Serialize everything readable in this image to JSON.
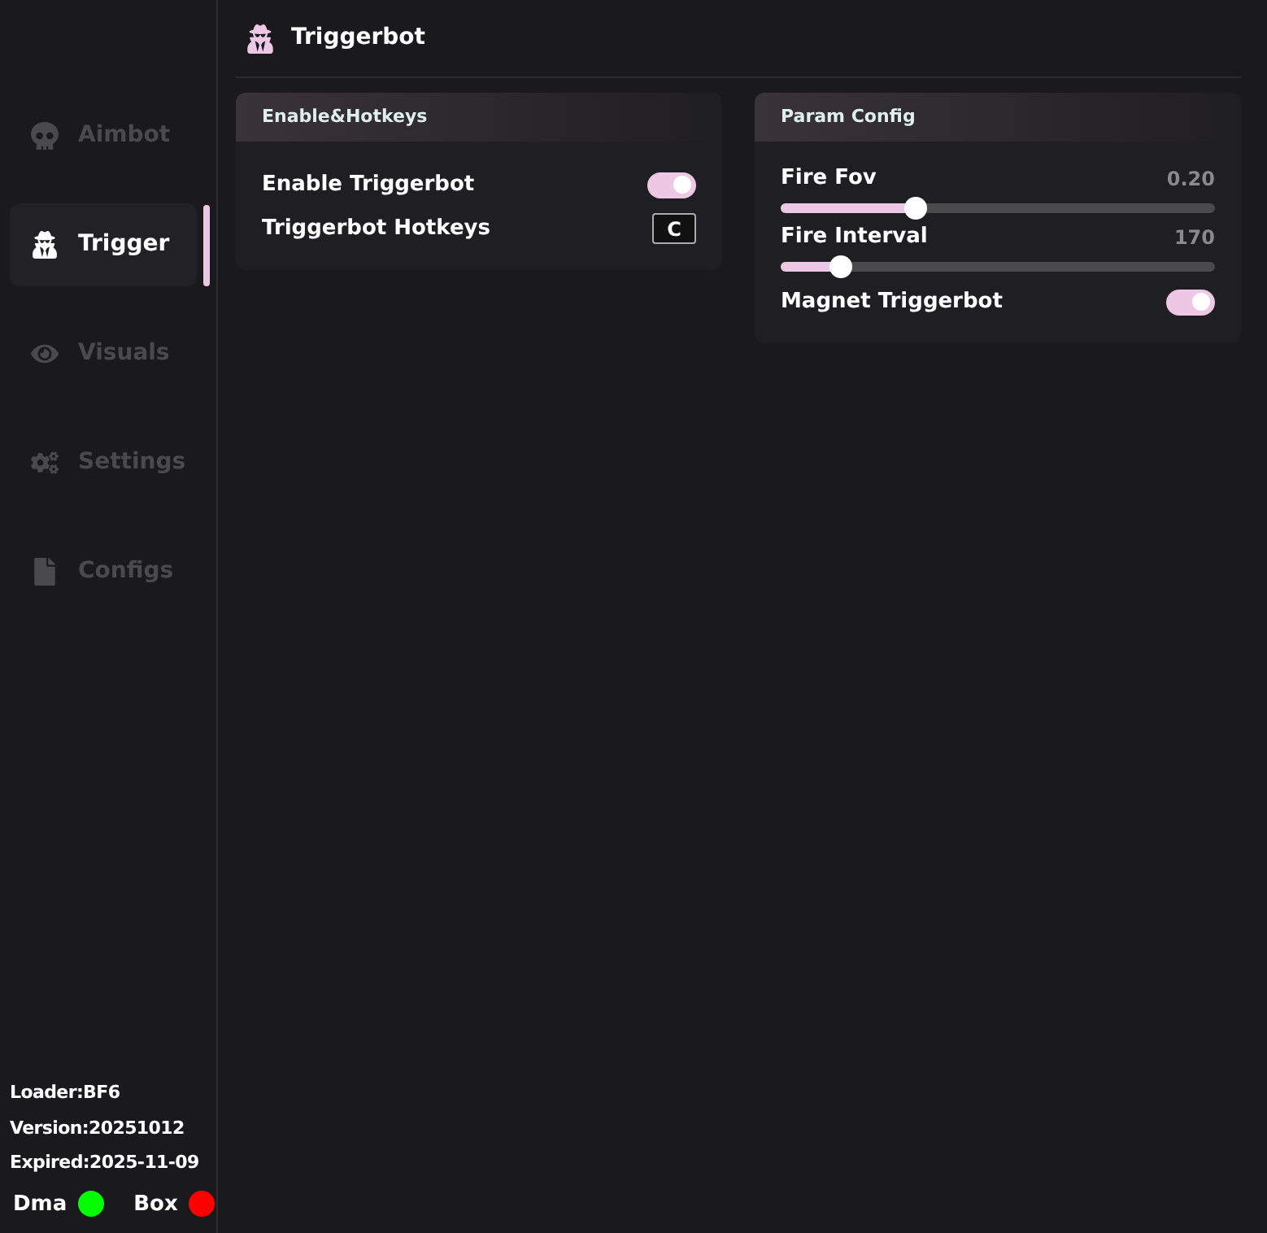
{
  "sidebar": {
    "items": [
      {
        "label": "Aimbot",
        "kind": "skull",
        "selected": false
      },
      {
        "label": "Trigger",
        "kind": "spy",
        "selected": true
      },
      {
        "label": "Visuals",
        "kind": "eye",
        "selected": false
      },
      {
        "label": "Settings",
        "kind": "gears",
        "selected": false
      },
      {
        "label": "Configs",
        "kind": "file",
        "selected": false
      }
    ],
    "info": [
      "Loader:BF6",
      "Version:20251012",
      "Expired:2025-11-09"
    ],
    "status": [
      {
        "label": "Dma",
        "color": "#00ff00"
      },
      {
        "label": "Box",
        "color": "#ff0000"
      }
    ]
  },
  "header": {
    "title": "Triggerbot"
  },
  "panels": [
    {
      "title": "Enable&Hotkeys",
      "rows": [
        {
          "kind": "toggle",
          "label": "Enable Triggerbot",
          "on": true
        },
        {
          "kind": "hotkey",
          "label": "Triggerbot Hotkeys",
          "key": "C"
        }
      ]
    },
    {
      "title": "Param Config",
      "rows": [
        {
          "kind": "slider",
          "label": "Fire Fov",
          "reading": "0.20",
          "level": 0.31
        },
        {
          "kind": "slider",
          "label": "Fire Interval",
          "reading": "170",
          "level": 0.14
        },
        {
          "kind": "toggle",
          "label": "Magnet Triggerbot",
          "on": true
        }
      ]
    }
  ]
}
